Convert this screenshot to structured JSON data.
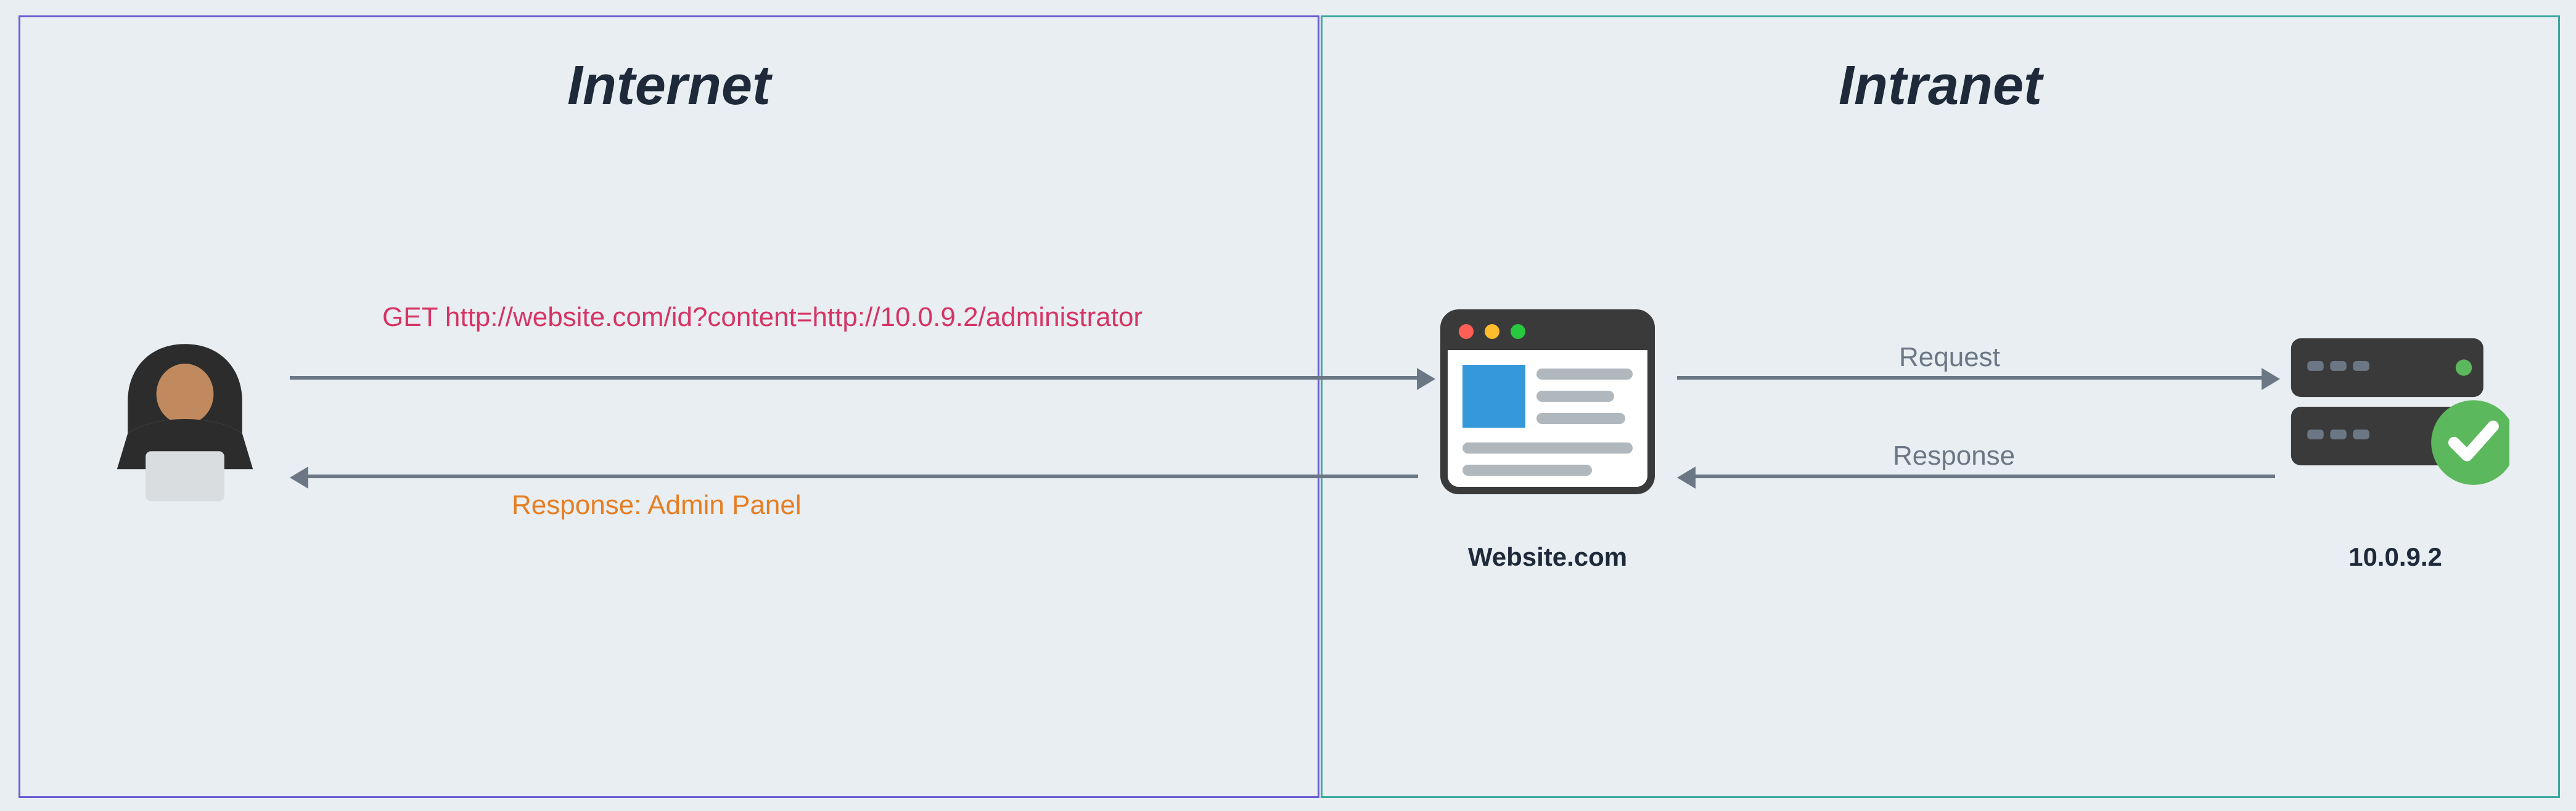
{
  "zones": {
    "internet": {
      "title": "Internet"
    },
    "intranet": {
      "title": "Intranet"
    }
  },
  "nodes": {
    "attacker": {
      "label": ""
    },
    "browser": {
      "label": "Website.com"
    },
    "server": {
      "label": "10.0.9.2"
    }
  },
  "arrows": {
    "request_external": {
      "label": "GET http://website.com/id?content=http://10.0.9.2/administrator"
    },
    "response_external": {
      "label": "Response: Admin Panel"
    },
    "request_internal": {
      "label": "Request"
    },
    "response_internal": {
      "label": "Response"
    }
  },
  "colors": {
    "internet_border": "#6b5bd4",
    "intranet_border": "#3aa99f",
    "request_text": "#d63465",
    "response_text": "#e67e22",
    "arrow": "#6b7785",
    "check_badge": "#5cb85c"
  }
}
